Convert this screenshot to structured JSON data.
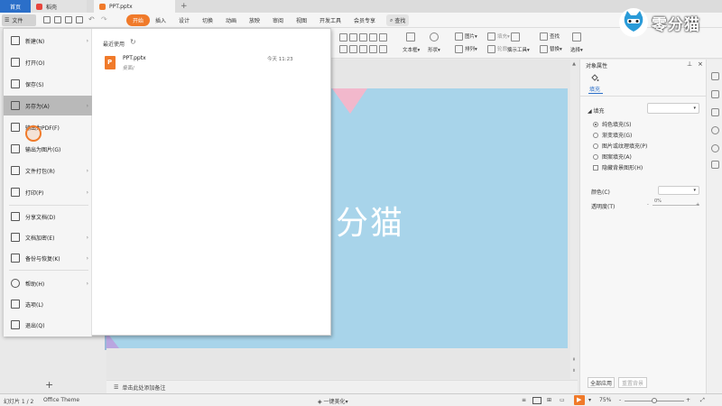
{
  "titlebar": {
    "tabs": [
      {
        "label": "首页"
      },
      {
        "label": "稻壳"
      },
      {
        "label": "PPT.pptx"
      }
    ],
    "new_tab": "+"
  },
  "menubar": {
    "file_label": "文件",
    "tabs": [
      "开始",
      "插入",
      "设计",
      "切换",
      "动画",
      "放映",
      "审阅",
      "视图",
      "开发工具",
      "会员专享"
    ],
    "active_tab": "开始",
    "search_label": "查找"
  },
  "logo": {
    "text": "零分猫"
  },
  "ribbon": {
    "labels": [
      "文本框",
      "形状",
      "图片",
      "填充",
      "排列",
      "轮廓",
      "演示工具",
      "查找",
      "替换",
      "选择"
    ]
  },
  "file_menu": {
    "items": [
      {
        "label": "新建(N)",
        "icon": "new-doc-icon",
        "has_submenu": true
      },
      {
        "label": "打开(O)",
        "icon": "open-folder-icon",
        "has_submenu": false
      },
      {
        "label": "保存(S)",
        "icon": "save-icon",
        "has_submenu": false
      },
      {
        "label": "另存为(A)",
        "icon": "save-as-icon",
        "has_submenu": true,
        "highlighted": true
      },
      {
        "label": "输出为PDF(F)",
        "icon": "pdf-icon",
        "has_submenu": false
      },
      {
        "label": "输出为图片(G)",
        "icon": "image-export-icon",
        "has_submenu": false
      },
      {
        "label": "文件打包(R)",
        "icon": "package-icon",
        "has_submenu": true
      },
      {
        "label": "打印(P)",
        "icon": "print-icon",
        "has_submenu": true
      },
      {
        "label": "分享文档(D)",
        "icon": "share-icon",
        "has_submenu": false
      },
      {
        "label": "文档加密(E)",
        "icon": "encrypt-icon",
        "has_submenu": true
      },
      {
        "label": "备份与恢复(K)",
        "icon": "backup-icon",
        "has_submenu": true
      },
      {
        "label": "帮助(H)",
        "icon": "help-icon",
        "has_submenu": true
      },
      {
        "label": "选项(L)",
        "icon": "options-icon",
        "has_submenu": false
      },
      {
        "label": "退出(Q)",
        "icon": "exit-icon",
        "has_submenu": false
      }
    ],
    "recent": {
      "title": "最近使用",
      "files": [
        {
          "name": "PPT.pptx",
          "path": "桌面/",
          "time": "今天 11:23"
        }
      ]
    }
  },
  "slide": {
    "text": "分猫",
    "bg_color": "#a8d4ea"
  },
  "notes": {
    "placeholder": "单击此处添加备注"
  },
  "right_panel": {
    "title": "对象属性",
    "tab": "填充",
    "section": "填充",
    "fill_options": [
      {
        "label": "纯色填充(S)",
        "checked": true
      },
      {
        "label": "渐变填充(G)",
        "checked": false
      },
      {
        "label": "图片或纹理填充(P)",
        "checked": false
      },
      {
        "label": "图案填充(A)",
        "checked": false
      }
    ],
    "hide_bg": "隐藏背景图形(H)",
    "color_label": "颜色(C)",
    "transparency_label": "透明度(T)",
    "transparency_value": "0%",
    "apply_all": "全部应用",
    "reset_bg": "重置背景"
  },
  "statusbar": {
    "slide_count": "幻灯片 1 / 2",
    "theme": "Office Theme",
    "beautify": "一键美化",
    "zoom": "75%"
  },
  "colors": {
    "accent": "#f07a2a",
    "home_tab": "#2b6fc9"
  }
}
